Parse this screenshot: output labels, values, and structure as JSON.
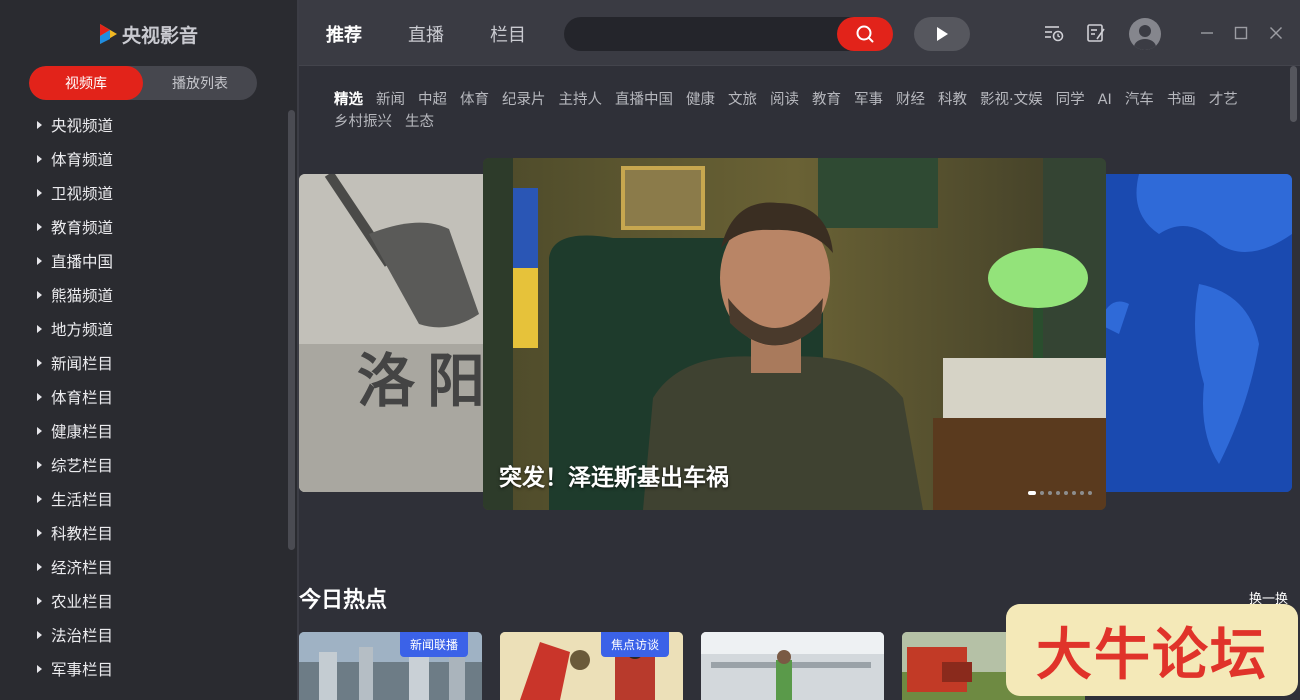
{
  "app": {
    "name": "央视影音"
  },
  "sidebar": {
    "tabs": [
      {
        "label": "视频库"
      },
      {
        "label": "播放列表"
      }
    ],
    "channels": [
      {
        "label": "央视频道"
      },
      {
        "label": "体育频道"
      },
      {
        "label": "卫视频道"
      },
      {
        "label": "教育频道"
      },
      {
        "label": "直播中国"
      },
      {
        "label": "熊猫频道"
      },
      {
        "label": "地方频道"
      },
      {
        "label": "新闻栏目"
      },
      {
        "label": "体育栏目"
      },
      {
        "label": "健康栏目"
      },
      {
        "label": "综艺栏目"
      },
      {
        "label": "生活栏目"
      },
      {
        "label": "科教栏目"
      },
      {
        "label": "经济栏目"
      },
      {
        "label": "农业栏目"
      },
      {
        "label": "法治栏目"
      },
      {
        "label": "军事栏目"
      }
    ]
  },
  "header": {
    "tabs": [
      {
        "label": "推荐"
      },
      {
        "label": "直播"
      },
      {
        "label": "栏目"
      }
    ],
    "search": {
      "placeholder": ""
    },
    "icons": [
      "history-icon",
      "note-icon",
      "user-avatar-icon",
      "minimize-icon",
      "maximize-icon",
      "close-icon"
    ]
  },
  "categories": [
    "精选",
    "新闻",
    "中超",
    "体育",
    "纪录片",
    "主持人",
    "直播中国",
    "健康",
    "文旅",
    "阅读",
    "教育",
    "军事",
    "财经",
    "科教",
    "影视·文娱",
    "同学",
    "AI",
    "汽车",
    "书画",
    "才艺",
    "乡村振兴",
    "生态"
  ],
  "carousel": {
    "left_text": "洛阳",
    "caption": "突发！泽连斯基出车祸",
    "slide_count": 8,
    "current_slide": 1
  },
  "hot": {
    "title": "今日热点",
    "refresh_label": "换一换",
    "items": [
      {
        "badge": "新闻联播"
      },
      {
        "badge": "焦点访谈"
      },
      {
        "badge": ""
      },
      {
        "badge": ""
      }
    ]
  },
  "watermark": {
    "text": "大牛论坛"
  },
  "colors": {
    "accent": "#e2231a",
    "badge": "#3b62e8",
    "sidebar_bg": "#2a2b30",
    "main_bg": "#2f3038"
  }
}
